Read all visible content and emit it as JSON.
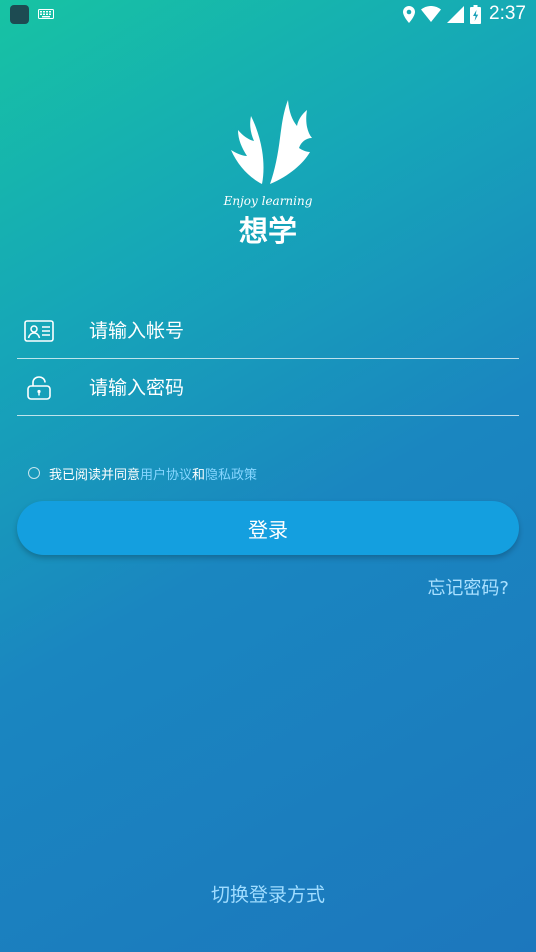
{
  "status_bar": {
    "time": "2:37",
    "icons": [
      "app-icon",
      "keyboard-icon",
      "location-icon",
      "wifi-icon",
      "signal-icon",
      "battery-icon"
    ]
  },
  "logo": {
    "tagline": "Enjoy learning",
    "brand": "想学"
  },
  "login_form": {
    "account_placeholder": "请输入帐号",
    "password_placeholder": "请输入密码",
    "account_icon": "id-card-icon",
    "password_icon": "lock-icon"
  },
  "agreement": {
    "prefix": "我已阅读并同意",
    "user_agreement": "用户协议",
    "conjunction": "和",
    "privacy_policy": "隐私政策",
    "checked": false
  },
  "actions": {
    "login_label": "登录",
    "forgot_password": "忘记密码?",
    "switch_login": "切换登录方式"
  },
  "colors": {
    "gradient_start": "#17c3a3",
    "gradient_end": "#1c77bd",
    "button": "#149fdf",
    "link": "#86d6ff"
  }
}
